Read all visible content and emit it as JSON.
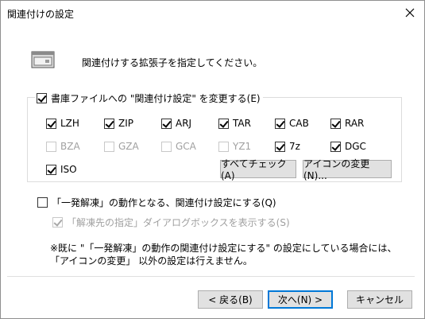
{
  "window": {
    "title": "関連付けの設定"
  },
  "intro": {
    "text": "関連付けする拡張子を指定してください。",
    "icon": "window-icon"
  },
  "group": {
    "label": "書庫ファイルへの \"関連付け設定\" を変更する(E)",
    "checked": true
  },
  "extensions": [
    {
      "label": "LZH",
      "checked": true,
      "enabled": true
    },
    {
      "label": "ZIP",
      "checked": true,
      "enabled": true
    },
    {
      "label": "ARJ",
      "checked": true,
      "enabled": true
    },
    {
      "label": "TAR",
      "checked": true,
      "enabled": true
    },
    {
      "label": "CAB",
      "checked": true,
      "enabled": true
    },
    {
      "label": "RAR",
      "checked": true,
      "enabled": true
    },
    {
      "label": "BZA",
      "checked": false,
      "enabled": false
    },
    {
      "label": "GZA",
      "checked": false,
      "enabled": false
    },
    {
      "label": "GCA",
      "checked": false,
      "enabled": false
    },
    {
      "label": "YZ1",
      "checked": false,
      "enabled": false
    },
    {
      "label": "7z",
      "checked": true,
      "enabled": true
    },
    {
      "label": "DGC",
      "checked": true,
      "enabled": true
    },
    {
      "label": "ISO",
      "checked": true,
      "enabled": true
    }
  ],
  "buttons": {
    "check_all": "すべてチェック(A)",
    "change_icon": "アイコンの変更(N)...",
    "back": "< 戻る(B)",
    "next": "次へ(N) >",
    "cancel": "キャンセル"
  },
  "options": {
    "one_click": {
      "label": "「一発解凍」の動作となる、関連付け設定にする(Q)",
      "checked": false
    },
    "show_dialog": {
      "label": "「解凍先の指定」ダイアログボックスを表示する(S)",
      "checked": true,
      "enabled": false
    }
  },
  "note": {
    "line1": "※既に \"「一発解凍」の動作の関連付け設定にする\" の設定にしている場合には、",
    "line2": "「アイコンの変更」 以外の設定は行えません。"
  }
}
